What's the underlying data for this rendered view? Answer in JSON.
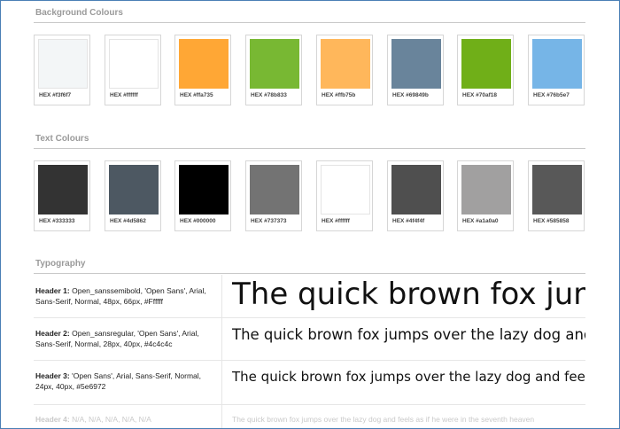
{
  "background_section": {
    "title": "Background Colours",
    "swatches": [
      {
        "label": "HEX #f3f6f7",
        "color": "#f3f6f7"
      },
      {
        "label": "HEX #ffffff",
        "color": "#ffffff"
      },
      {
        "label": "HEX #ffa735",
        "color": "#ffa735"
      },
      {
        "label": "HEX #78b833",
        "color": "#78b833"
      },
      {
        "label": "HEX #ffb75b",
        "color": "#ffb75b"
      },
      {
        "label": "HEX #69849b",
        "color": "#69849b"
      },
      {
        "label": "HEX #70af18",
        "color": "#70af18"
      },
      {
        "label": "HEX #76b5e7",
        "color": "#76b5e7"
      }
    ]
  },
  "text_section": {
    "title": "Text Colours",
    "swatches": [
      {
        "label": "HEX #333333",
        "color": "#333333"
      },
      {
        "label": "HEX #4d5862",
        "color": "#4d5862"
      },
      {
        "label": "HEX #000000",
        "color": "#000000"
      },
      {
        "label": "HEX #737373",
        "color": "#737373"
      },
      {
        "label": "HEX #ffffff",
        "color": "#ffffff"
      },
      {
        "label": "HEX #4f4f4f",
        "color": "#4f4f4f"
      },
      {
        "label": "HEX #a1a0a0",
        "color": "#a1a0a0"
      },
      {
        "label": "HEX #585858",
        "color": "#585858"
      }
    ]
  },
  "typography_section": {
    "title": "Typography",
    "rows": [
      {
        "name": "Header 1:",
        "spec": " Open_sanssemibold, 'Open Sans', Arial, Sans-Serif, Normal, 48px, 66px, #Ffffff",
        "sample": "The quick brown fox jumps over the lazy dog"
      },
      {
        "name": "Header 2:",
        "spec": " Open_sansregular, 'Open Sans', Arial, Sans-Serif, Normal, 28px, 40px, #4c4c4c",
        "sample": "The quick brown fox jumps over the lazy dog and feels"
      },
      {
        "name": "Header 3:",
        "spec": " 'Open Sans', Arial, Sans-Serif, Normal, 24px, 40px, #5e6972",
        "sample": "The quick brown fox jumps over the lazy dog and feels"
      },
      {
        "name": "Header 4:",
        "spec": " N/A, N/A, N/A, N/A, N/A",
        "sample": "The quick brown fox jumps over the lazy dog and feels as if he were in the seventh heaven"
      }
    ]
  }
}
